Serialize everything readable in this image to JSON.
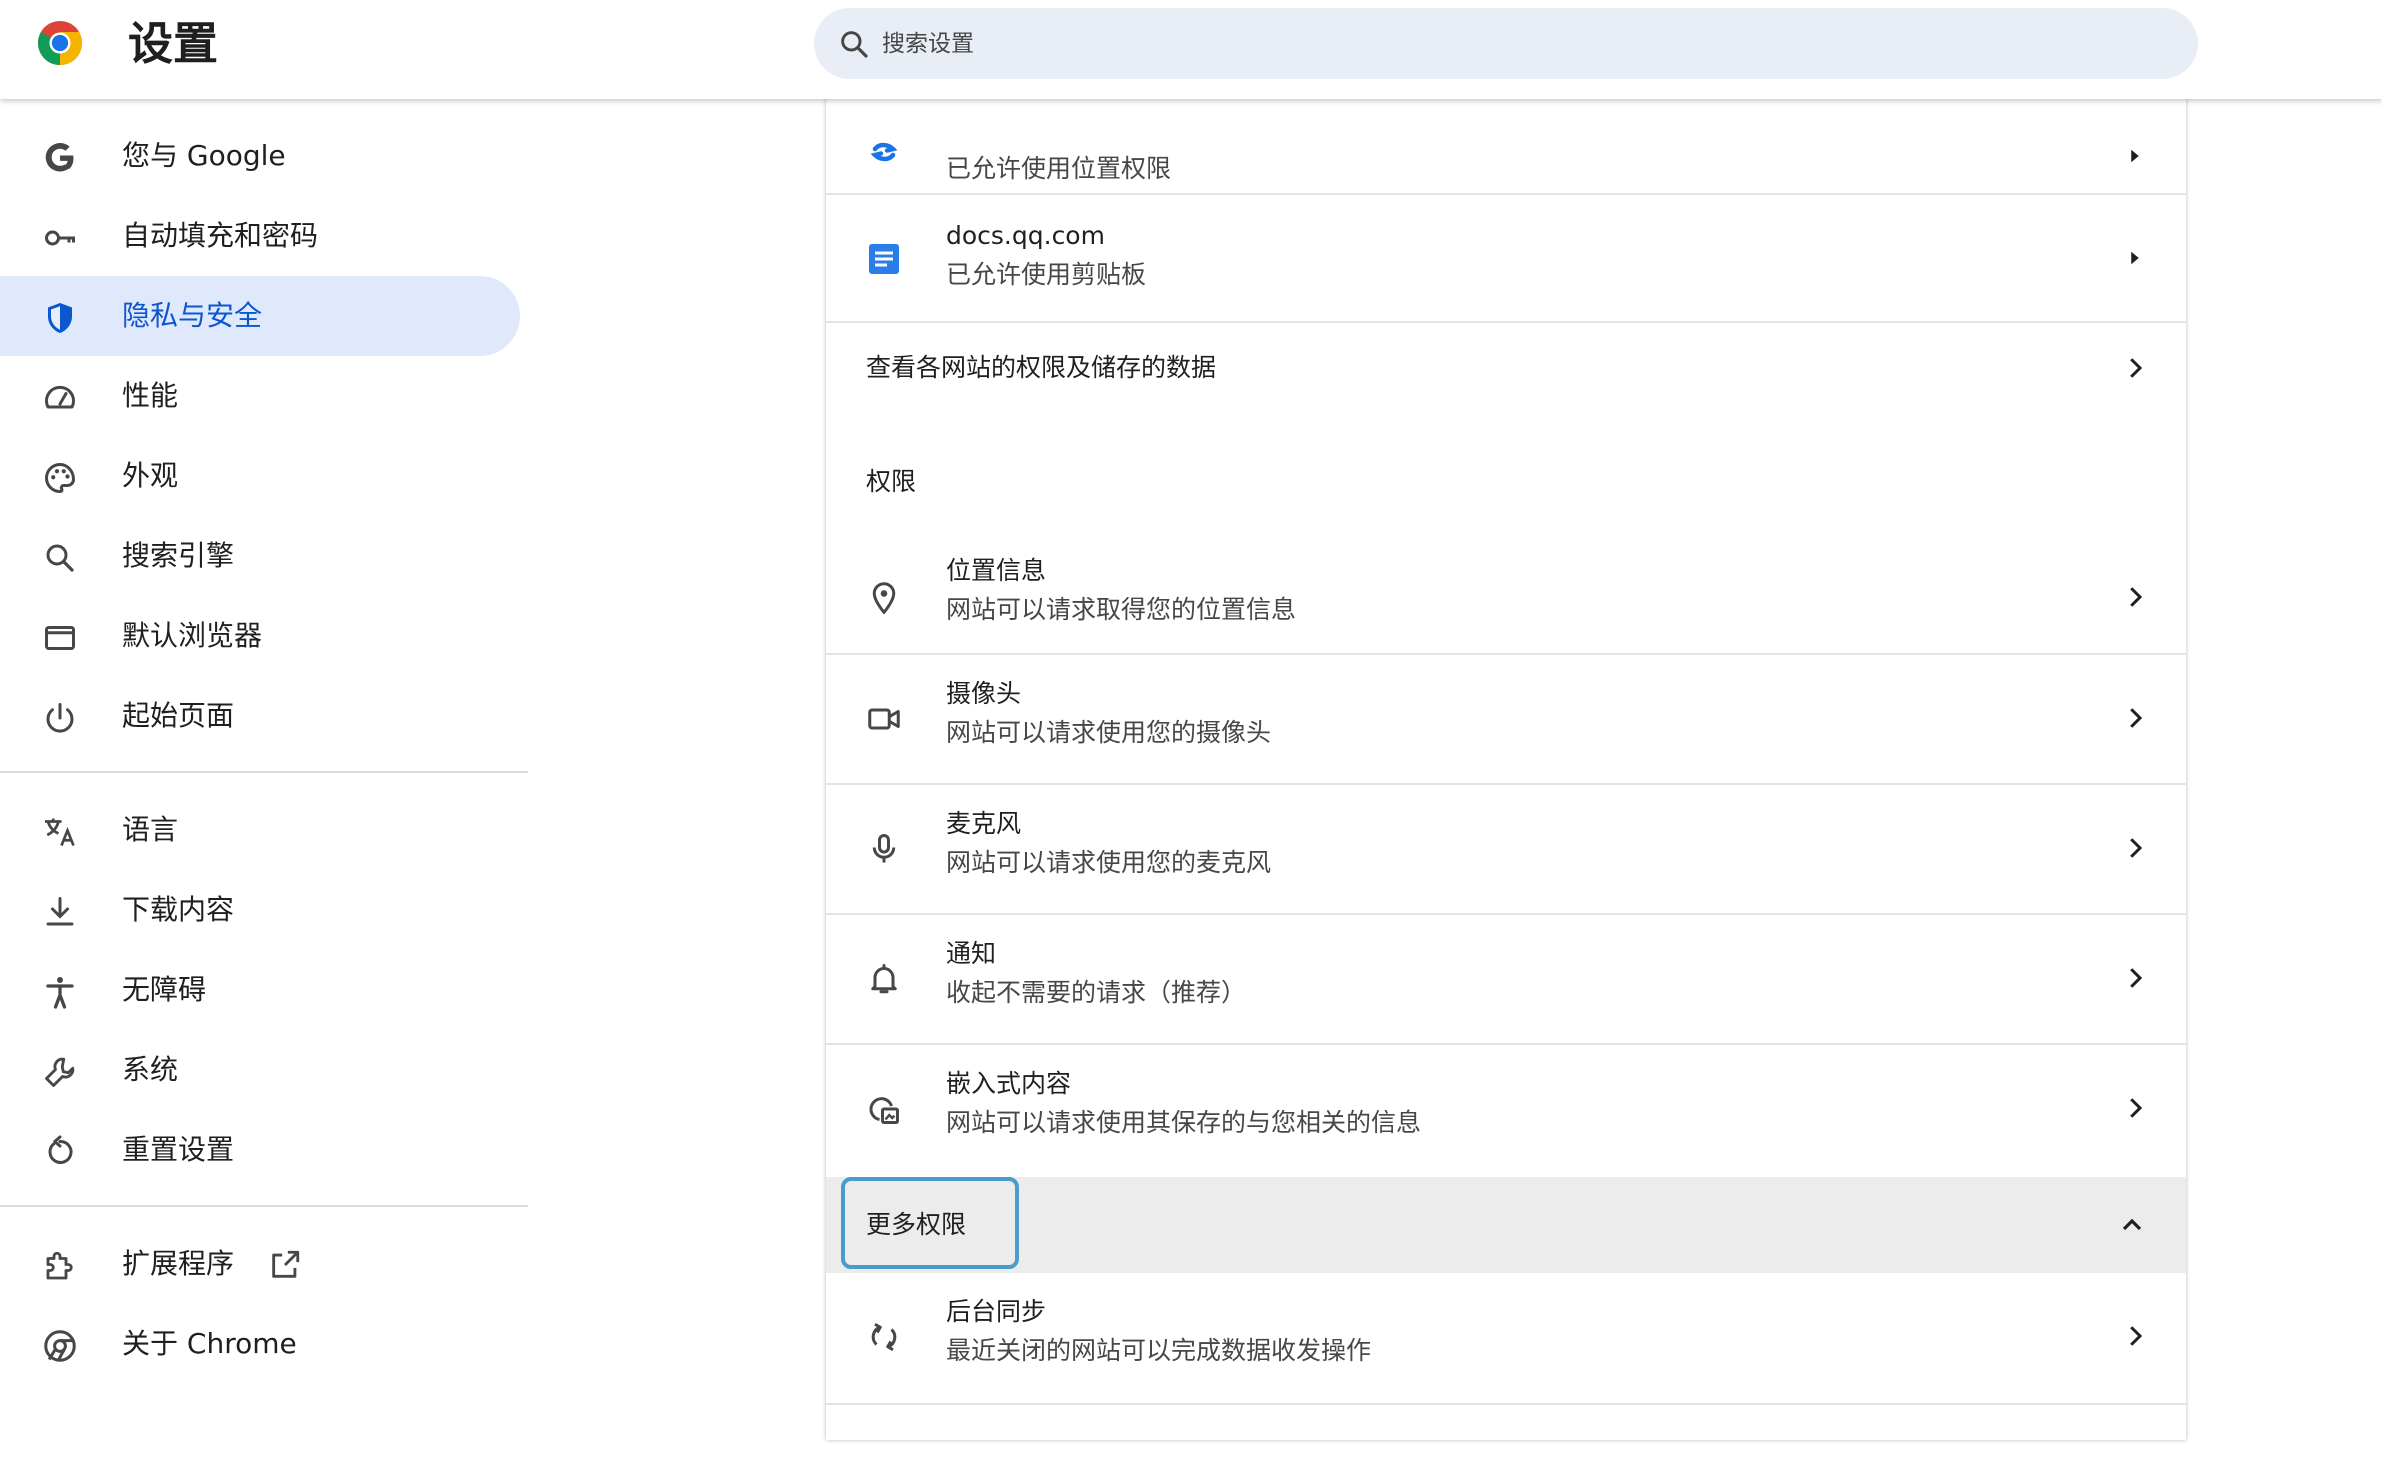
{
  "header": {
    "title": "设置",
    "search_placeholder": "搜索设置"
  },
  "sidebar": {
    "items": [
      {
        "label": "您与 Google",
        "icon": "google-g-icon"
      },
      {
        "label": "自动填充和密码",
        "icon": "key-icon"
      },
      {
        "label": "隐私与安全",
        "icon": "shield-icon",
        "active": true
      },
      {
        "label": "性能",
        "icon": "speedometer-icon"
      },
      {
        "label": "外观",
        "icon": "palette-icon"
      },
      {
        "label": "搜索引擎",
        "icon": "search-icon"
      },
      {
        "label": "默认浏览器",
        "icon": "browser-window-icon"
      },
      {
        "label": "起始页面",
        "icon": "power-icon"
      },
      {
        "label": "语言",
        "icon": "translate-icon"
      },
      {
        "label": "下载内容",
        "icon": "download-icon"
      },
      {
        "label": "无障碍",
        "icon": "accessibility-icon"
      },
      {
        "label": "系统",
        "icon": "wrench-icon"
      },
      {
        "label": "重置设置",
        "icon": "reset-icon"
      },
      {
        "label": "扩展程序",
        "icon": "puzzle-icon"
      },
      {
        "label": "关于 Chrome",
        "icon": "chrome-icon"
      }
    ]
  },
  "sites": [
    {
      "subtitle": "已允许使用位置权限",
      "icon": "site-favicon-icon"
    },
    {
      "title": "docs.qq.com",
      "subtitle": "已允许使用剪贴板",
      "icon": "docs-favicon-icon"
    }
  ],
  "view_all": "查看各网站的权限及储存的数据",
  "permissions": {
    "heading": "权限",
    "items": [
      {
        "title": "位置信息",
        "subtitle": "网站可以请求取得您的位置信息",
        "icon": "location-pin-icon"
      },
      {
        "title": "摄像头",
        "subtitle": "网站可以请求使用您的摄像头",
        "icon": "camera-icon"
      },
      {
        "title": "麦克风",
        "subtitle": "网站可以请求使用您的麦克风",
        "icon": "microphone-icon"
      },
      {
        "title": "通知",
        "subtitle": "收起不需要的请求（推荐）",
        "icon": "bell-icon"
      },
      {
        "title": "嵌入式内容",
        "subtitle": "网站可以请求使用其保存的与您相关的信息",
        "icon": "embedded-content-icon"
      }
    ]
  },
  "more_permissions": {
    "label": "更多权限",
    "items": [
      {
        "title": "后台同步",
        "subtitle": "最近关闭的网站可以完成数据收发操作",
        "icon": "sync-icon"
      }
    ]
  },
  "colors": {
    "accent": "#0b57d0",
    "active_bg": "#e0e9fb",
    "search_bg": "#e9eef6",
    "focus_ring": "#4a9ccc"
  }
}
